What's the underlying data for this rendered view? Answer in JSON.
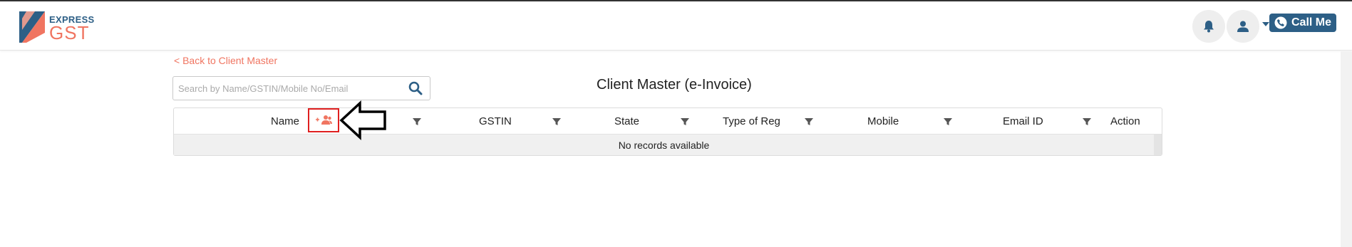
{
  "brand": {
    "express": "EXPRESS",
    "gst": "GST",
    "color_primary": "#2d5f86",
    "color_accent": "#f07561"
  },
  "header": {
    "bell_icon": "bell-icon",
    "user_icon": "user-icon",
    "call_me_label": "Call Me",
    "call_icon": "phone-icon"
  },
  "nav": {
    "back_label": "< Back to Client Master"
  },
  "search": {
    "placeholder": "Search by Name/GSTIN/Mobile No/Email",
    "value": ""
  },
  "page": {
    "title": "Client Master (e-Invoice)"
  },
  "grid": {
    "columns": [
      {
        "label": "Name",
        "filter": true
      },
      {
        "label": "GSTIN",
        "filter": true
      },
      {
        "label": "State",
        "filter": true
      },
      {
        "label": "Type of Reg",
        "filter": true
      },
      {
        "label": "Mobile",
        "filter": true
      },
      {
        "label": "Email ID",
        "filter": true
      },
      {
        "label": "Action",
        "filter": false
      }
    ],
    "empty_message": "No records available",
    "add_client_icon": "add-users-icon",
    "highlight_color": "#e02020"
  }
}
